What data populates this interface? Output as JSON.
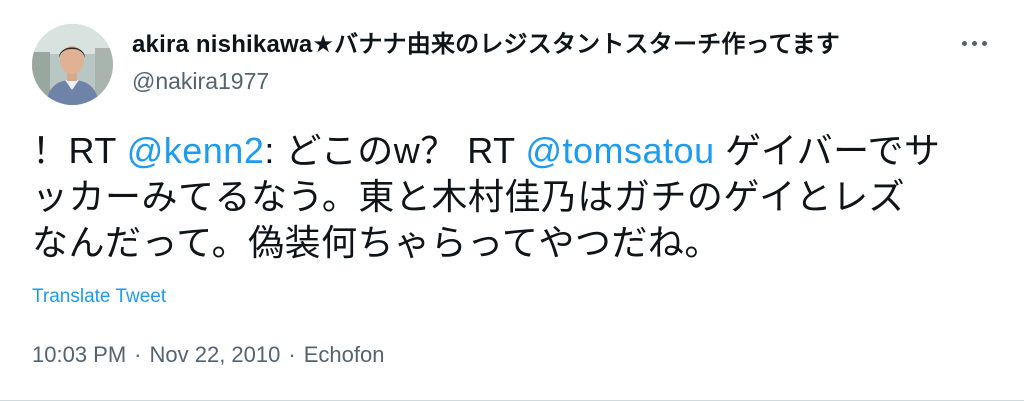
{
  "user": {
    "display_name": "akira nishikawa★バナナ由来のレジスタントスターチ作ってます",
    "handle": "@nakira1977"
  },
  "tweet": {
    "line1": {
      "prefix": "！RT ",
      "mention1": "@kenn2",
      "middle": ": どこのw？ RT ",
      "mention2": "@tomsatou",
      "suffix": " ゲイバーでサ"
    },
    "line2": "ッカーみてるなう。東と木村佳乃はガチのゲイとレズ",
    "line3": "なんだって。偽装何ちゃらってやつだね。"
  },
  "translate_label": "Translate Tweet",
  "meta": {
    "time": "10:03 PM",
    "separator": "·",
    "date": "Nov 22, 2010",
    "source": "Echofon"
  },
  "icons": {
    "more": "more-horizontal-icon",
    "avatar": "profile-photo"
  },
  "colors": {
    "link": "#1d9bf0",
    "text": "#0f1419",
    "secondary": "#536471",
    "divider": "#cfd9de"
  }
}
